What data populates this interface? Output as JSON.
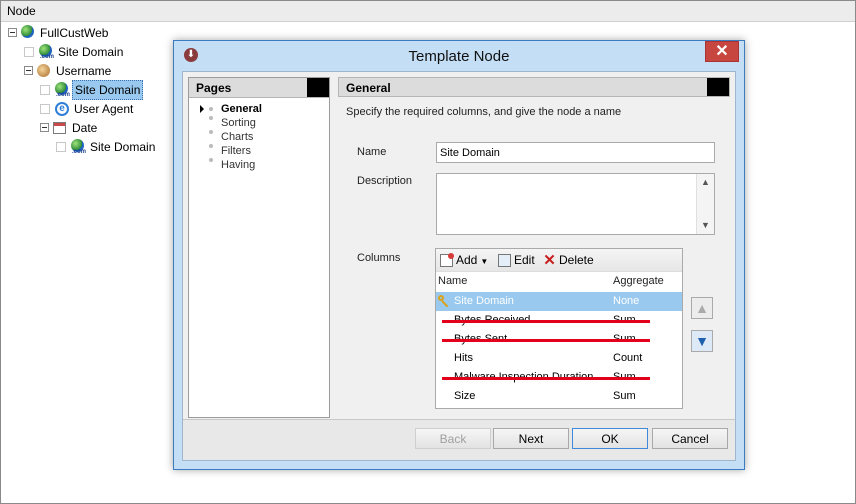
{
  "tree": {
    "header": "Node",
    "nodes": [
      {
        "label": "FullCustWeb"
      },
      {
        "label": "Site Domain"
      },
      {
        "label": "Username"
      },
      {
        "label": "Site Domain"
      },
      {
        "label": "User Agent"
      },
      {
        "label": "Date"
      },
      {
        "label": "Site Domain"
      }
    ],
    "com_tag": ".com"
  },
  "dialog": {
    "title": "Template Node",
    "close_glyph": "✕",
    "pages_header": "Pages",
    "pages": [
      "General",
      "Sorting",
      "Charts",
      "Filters",
      "Having"
    ],
    "active_page": "General",
    "section_header": "General",
    "instruction": "Specify the required columns, and give the node a name",
    "name_label": "Name",
    "name_value": "Site Domain",
    "description_label": "Description",
    "description_value": "",
    "columns_label": "Columns",
    "toolbar": {
      "add": "Add",
      "edit": "Edit",
      "delete": "Delete"
    },
    "columns_headers": {
      "name": "Name",
      "aggregate": "Aggregate"
    },
    "columns": [
      {
        "name": "Site Domain",
        "aggregate": "None",
        "selected": true,
        "struck": false
      },
      {
        "name": "Bytes Received",
        "aggregate": "Sum",
        "selected": false,
        "struck": true
      },
      {
        "name": "Bytes Sent",
        "aggregate": "Sum",
        "selected": false,
        "struck": true
      },
      {
        "name": "Hits",
        "aggregate": "Count",
        "selected": false,
        "struck": false
      },
      {
        "name": "Malware Inspection Duration",
        "aggregate": "Sum",
        "selected": false,
        "struck": true
      },
      {
        "name": "Size",
        "aggregate": "Sum",
        "selected": false,
        "struck": false
      }
    ],
    "buttons": {
      "back": "Back",
      "next": "Next",
      "ok": "OK",
      "cancel": "Cancel"
    },
    "strike_color": "#e2001a",
    "selection_color": "#99c9ef"
  }
}
